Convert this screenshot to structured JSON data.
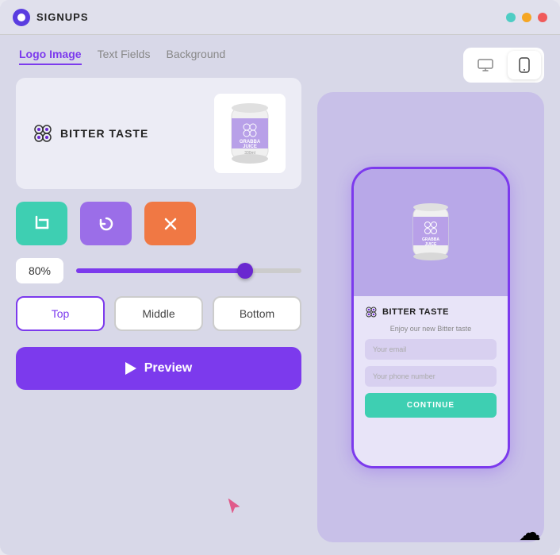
{
  "app": {
    "title": "SIGNUPS"
  },
  "titlebar": {
    "dots": [
      {
        "color": "teal",
        "label": "teal-dot"
      },
      {
        "color": "yellow",
        "label": "yellow-dot"
      },
      {
        "color": "red",
        "label": "red-dot"
      }
    ]
  },
  "tabs": [
    {
      "label": "Logo Image",
      "active": true
    },
    {
      "label": "Text Fields",
      "active": false
    },
    {
      "label": "Background",
      "active": false
    }
  ],
  "brand": {
    "name": "BITTER TASTE"
  },
  "action_buttons": [
    {
      "icon": "✂",
      "label": "crop",
      "color": "teal"
    },
    {
      "icon": "↺",
      "label": "rotate",
      "color": "purple"
    },
    {
      "icon": "×",
      "label": "remove",
      "color": "orange"
    }
  ],
  "slider": {
    "value": "80%",
    "fill_percent": 75
  },
  "position": {
    "options": [
      "Top",
      "Middle",
      "Bottom"
    ],
    "active": "Top"
  },
  "preview_button": {
    "label": "Preview"
  },
  "device_toggle": [
    {
      "icon": "desktop",
      "active": false
    },
    {
      "icon": "mobile",
      "active": true
    }
  ],
  "phone_preview": {
    "tagline": "Enjoy our new Bitter taste",
    "email_placeholder": "Your email",
    "phone_placeholder": "Your phone number",
    "cta_label": "CONTINUE",
    "brand_name": "BITTER TASTE"
  }
}
